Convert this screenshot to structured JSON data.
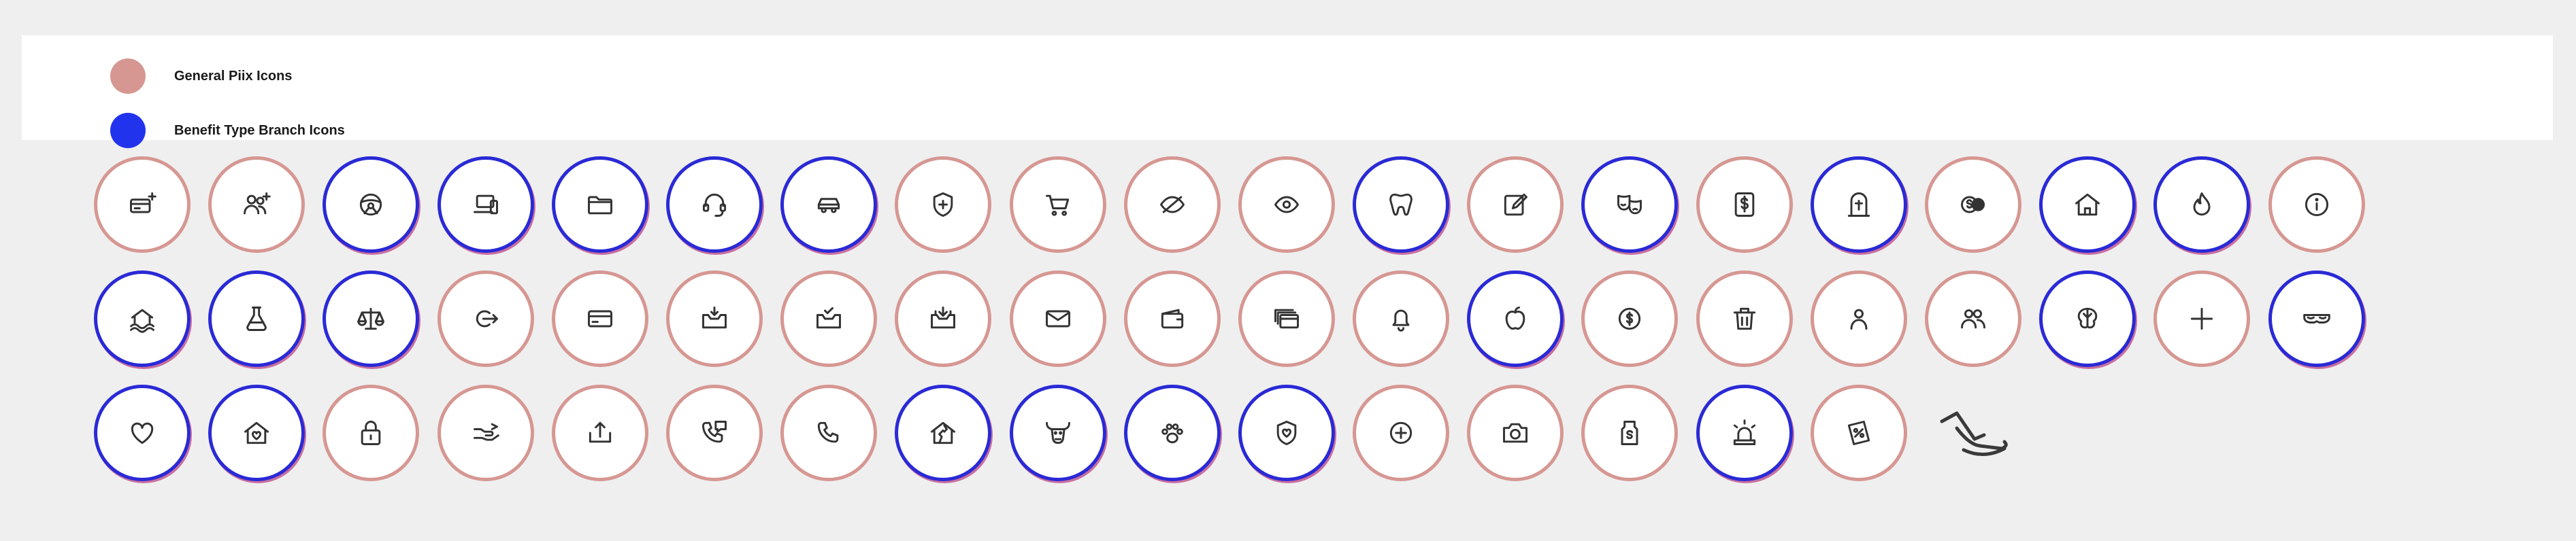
{
  "legend": {
    "items": [
      {
        "label": "General Piix Icons",
        "color": "#d69792"
      },
      {
        "label": "Benefit Type Branch Icons",
        "color": "#2233ee"
      }
    ]
  },
  "icon_rows": [
    [
      {
        "icon": "card-plus-icon",
        "group": "general"
      },
      {
        "icon": "users-plus-icon",
        "group": "general"
      },
      {
        "icon": "steering-wheel-icon",
        "group": "benefit"
      },
      {
        "icon": "devices-icon",
        "group": "benefit"
      },
      {
        "icon": "folder-icon",
        "group": "benefit"
      },
      {
        "icon": "headset-icon",
        "group": "benefit"
      },
      {
        "icon": "car-icon",
        "group": "benefit"
      },
      {
        "icon": "shield-plus-icon",
        "group": "general"
      },
      {
        "icon": "cart-icon",
        "group": "general"
      },
      {
        "icon": "eye-off-icon",
        "group": "general"
      },
      {
        "icon": "eye-icon",
        "group": "general"
      },
      {
        "icon": "tooth-icon",
        "group": "benefit"
      },
      {
        "icon": "edit-icon",
        "group": "general"
      },
      {
        "icon": "theater-masks-icon",
        "group": "benefit"
      },
      {
        "icon": "dollar-document-icon",
        "group": "general"
      },
      {
        "icon": "tombstone-icon",
        "group": "benefit"
      },
      {
        "icon": "money-coins-icon",
        "group": "general"
      },
      {
        "icon": "home-icon",
        "group": "benefit"
      },
      {
        "icon": "flame-icon",
        "group": "benefit"
      },
      {
        "icon": "info-icon",
        "group": "general"
      }
    ],
    [
      {
        "icon": "house-flood-icon",
        "group": "benefit"
      },
      {
        "icon": "flask-icon",
        "group": "benefit"
      },
      {
        "icon": "scales-icon",
        "group": "benefit"
      },
      {
        "icon": "logout-icon",
        "group": "general"
      },
      {
        "icon": "credit-card-icon",
        "group": "general"
      },
      {
        "icon": "mail-inbox-icon",
        "group": "general"
      },
      {
        "icon": "mail-check-icon",
        "group": "general"
      },
      {
        "icon": "mail-download-icon",
        "group": "general"
      },
      {
        "icon": "mail-icon",
        "group": "general"
      },
      {
        "icon": "wallet-icon",
        "group": "general"
      },
      {
        "icon": "cards-stack-icon",
        "group": "general"
      },
      {
        "icon": "bell-icon",
        "group": "general"
      },
      {
        "icon": "apple-icon",
        "group": "benefit"
      },
      {
        "icon": "dollar-coin-icon",
        "group": "general"
      },
      {
        "icon": "trash-icon",
        "group": "general"
      },
      {
        "icon": "user-icon",
        "group": "general"
      },
      {
        "icon": "users-icon",
        "group": "general"
      },
      {
        "icon": "brain-icon",
        "group": "benefit"
      },
      {
        "icon": "plus-thin-icon",
        "group": "general"
      },
      {
        "icon": "mask-icon",
        "group": "benefit"
      }
    ],
    [
      {
        "icon": "heart-icon",
        "group": "benefit"
      },
      {
        "icon": "house-heart-icon",
        "group": "benefit"
      },
      {
        "icon": "padlock-icon",
        "group": "general"
      },
      {
        "icon": "hand-give-icon",
        "group": "general"
      },
      {
        "icon": "upload-tray-icon",
        "group": "general"
      },
      {
        "icon": "phone-chat-icon",
        "group": "general"
      },
      {
        "icon": "phone-icon",
        "group": "general"
      },
      {
        "icon": "house-damage-icon",
        "group": "benefit"
      },
      {
        "icon": "bull-icon",
        "group": "benefit"
      },
      {
        "icon": "paw-icon",
        "group": "benefit"
      },
      {
        "icon": "heart-shield-icon",
        "group": "benefit"
      },
      {
        "icon": "plus-circle-icon",
        "group": "general"
      },
      {
        "icon": "camera-icon",
        "group": "general"
      },
      {
        "icon": "price-tag-icon",
        "group": "general"
      },
      {
        "icon": "alarm-light-icon",
        "group": "benefit"
      },
      {
        "icon": "discount-tag-icon",
        "group": "general"
      }
    ]
  ],
  "loose_icon": "hand-give-large-icon"
}
